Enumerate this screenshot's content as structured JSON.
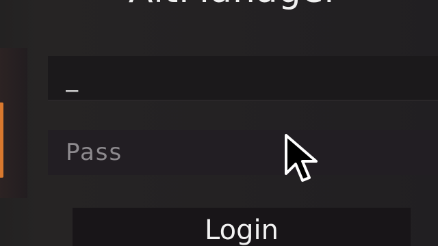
{
  "app": {
    "title": "AltManager"
  },
  "login_form": {
    "username": {
      "value": "_",
      "placeholder": ""
    },
    "password": {
      "value": "",
      "placeholder": "Pass"
    },
    "login_label": "Login"
  },
  "colors": {
    "background": "#232222",
    "field_background": "#1c1a1c",
    "accent": "#d9792e",
    "text": "#f0f0f0",
    "placeholder": "#8d8a8e"
  },
  "icons": {
    "cursor": "mouse-pointer-icon"
  }
}
